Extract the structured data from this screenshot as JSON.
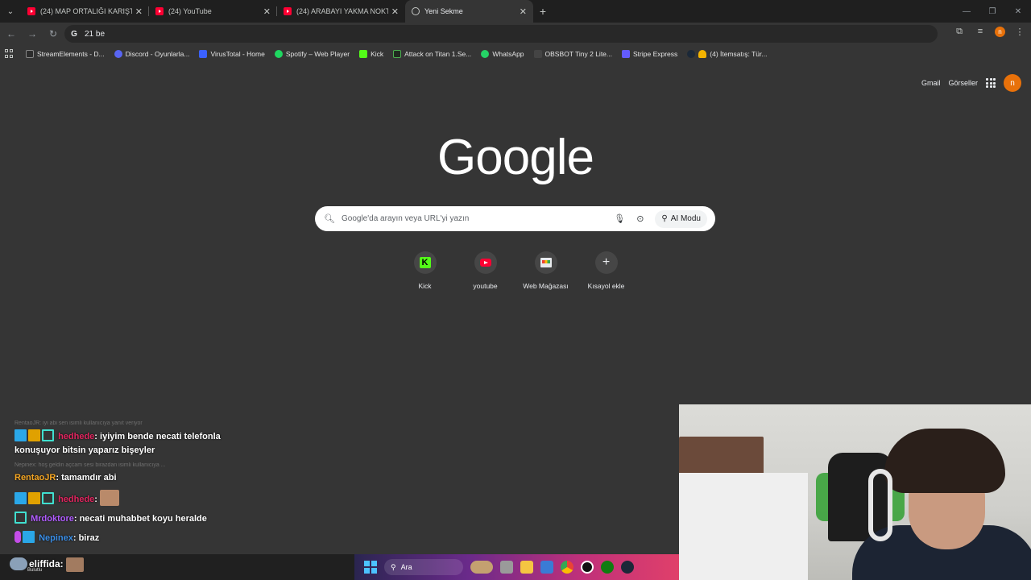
{
  "browser": {
    "tabs": [
      {
        "title": "(24) MAP ORTALIĞI KARIŞTIRDI",
        "active": false
      },
      {
        "title": "(24) YouTube",
        "active": false
      },
      {
        "title": "(24) ARABAYI YAKMA NOKTASI",
        "active": false
      },
      {
        "title": "Yeni Sekme",
        "active": true
      }
    ],
    "address": "21 be",
    "bookmarks": [
      {
        "label": "StreamElements - D...",
        "color": "#2c2c2c"
      },
      {
        "label": "Discord - Oyunlarla...",
        "color": "#5865f2"
      },
      {
        "label": "VirusTotal - Home",
        "color": "#3b61ff"
      },
      {
        "label": "Spotify – Web Player",
        "color": "#1ed760"
      },
      {
        "label": "Kick",
        "color": "#53fc18"
      },
      {
        "label": "Attack on Titan 1.Se...",
        "color": "#1f2a1f"
      },
      {
        "label": "WhatsApp",
        "color": "#25d366"
      },
      {
        "label": "OBSBOT Tiny 2 Lite...",
        "color": "#444444"
      },
      {
        "label": "Stripe Express",
        "color": "#635bff"
      },
      {
        "label": "(4) İtemsatış: Tür...",
        "color": "#3a8ee6"
      }
    ]
  },
  "ntp": {
    "links": {
      "gmail": "Gmail",
      "images": "Görseller"
    },
    "avatar_letter": "n",
    "logo": "Google",
    "search_placeholder": "Google'da arayın veya URL'yi yazın",
    "ai_mode": "AI Modu",
    "shortcuts": [
      {
        "label": "Kick",
        "icon": "kick-icon"
      },
      {
        "label": "youtube",
        "icon": "youtube-icon"
      },
      {
        "label": "Web Mağazası",
        "icon": "web-store-icon"
      },
      {
        "label": "Kısayol ekle",
        "icon": "plus-icon"
      }
    ]
  },
  "chat": {
    "reply1": "RentaoJR: iyi abi sen isimli kullanıcıya yanıt veriyor",
    "msg1_user": "hedhede",
    "msg1_text": ": iyiyim bende necati telefonla konuşuyor bitsin yaparız bişeyler",
    "reply2": "Nepinex: hoş geldin açcam sesi birazdan isimli kullanıcıya ...",
    "msg2_user": "RentaoJR",
    "msg2_text": ": tamamdır abi",
    "msg3_user": "hedhede",
    "msg3_text": ":",
    "msg4_user": "Mrdoktore",
    "msg4_text": ": necati muhabbet koyu heralde",
    "msg5_user": "Nepinex",
    "msg5_text": ": biraz",
    "bottom_user": "eliffida:",
    "bottom_sub": "Bulutlu",
    "colors": {
      "hedhede": "#e0245e",
      "RentaoJR": "#f5a623",
      "Mrdoktore": "#b05cff",
      "Nepinex": "#3a8ee6"
    }
  },
  "taskbar": {
    "search": "Ara"
  }
}
